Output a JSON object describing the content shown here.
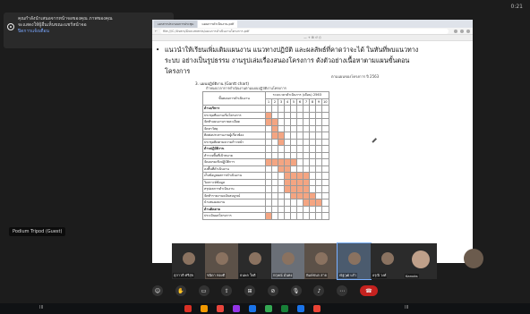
{
  "notice": {
    "line1": "คุณกำลังนำเสนอจากหน้าจอของคุณ ภาพของคุณ",
    "line2": "จะแสดงให้ผู้อื่นเห็นขณะแชร์หน้าจอ",
    "link": "ปิดการแจ้งเตือน"
  },
  "clock": "0:21",
  "browser": {
    "tabs": [
      "เอกสารประกอบการประชุม",
      "แผนการดำเนินงาน.pdf"
    ],
    "url": "file:///C:/Users/Documents/แผนการดำเนินงานโครงการ.pdf"
  },
  "doc": {
    "bullet": "แนวนำให้เรียนเพิ่มเติมแผนงาน แนวทางปฏิบัติ และผลลัพธ์ที่คาดว่าจะได้ ในทันที่พบแนวทางระบบ อย่างเป็นรูปธรรม งานรูปเล่มเรื่องสนองโครงการ ดังตัวอย่างเนื้อหาตามแผนขั้นตอนโครงการ",
    "page_note": "ตามแผนของโครงการ ปี 2563",
    "table_title": "3. แผนปฏิบัติงาน (Gantt chart)",
    "table_sub": "กำหนดเวลาการดำเนินงานตามแผนปฏิบัติงานโครงการ",
    "header_activity": "ขั้นตอนการดำเนินงาน",
    "header_period": "ระยะเวลาดำเนินการ (เดือน) 2563",
    "months": [
      "1",
      "2",
      "3",
      "4",
      "5",
      "6",
      "7",
      "8",
      "9",
      "10"
    ],
    "rows": [
      {
        "label": "ด้านบริหาร",
        "section": true,
        "cells": [
          0,
          0,
          0,
          0,
          0,
          0,
          0,
          0,
          0,
          0
        ]
      },
      {
        "label": "ประชุมทีมงานเริ่มโครงการ",
        "section": false,
        "cells": [
          1,
          0,
          0,
          0,
          0,
          0,
          0,
          0,
          0,
          0
        ]
      },
      {
        "label": "จัดทำแผนงานรายละเอียด",
        "section": false,
        "cells": [
          1,
          1,
          0,
          0,
          0,
          0,
          0,
          0,
          0,
          0
        ]
      },
      {
        "label": "จัดหาวัสดุ",
        "section": false,
        "cells": [
          0,
          1,
          0,
          0,
          0,
          0,
          0,
          0,
          0,
          0
        ]
      },
      {
        "label": "ติดต่อประสานงานผู้เกี่ยวข้อง",
        "section": false,
        "cells": [
          0,
          1,
          1,
          0,
          0,
          0,
          0,
          0,
          0,
          0
        ]
      },
      {
        "label": "ประชุมติดตามความก้าวหน้า",
        "section": false,
        "cells": [
          0,
          0,
          1,
          0,
          0,
          0,
          0,
          0,
          0,
          0
        ]
      },
      {
        "label": "ด้านปฏิบัติงาน",
        "section": true,
        "cells": [
          0,
          0,
          0,
          0,
          0,
          0,
          0,
          0,
          0,
          0
        ]
      },
      {
        "label": "สำรวจพื้นที่เป้าหมาย",
        "section": false,
        "cells": [
          0,
          0,
          0,
          0,
          0,
          0,
          0,
          0,
          0,
          0
        ]
      },
      {
        "label": "จัดอบรมเชิงปฏิบัติการ",
        "section": false,
        "cells": [
          1,
          1,
          1,
          1,
          1,
          0,
          0,
          0,
          0,
          0
        ]
      },
      {
        "label": "ลงพื้นที่ดำเนินงาน",
        "section": false,
        "cells": [
          0,
          0,
          1,
          1,
          0,
          0,
          0,
          0,
          0,
          0
        ]
      },
      {
        "label": "เก็บข้อมูลผลการดำเนินงาน",
        "section": false,
        "cells": [
          0,
          0,
          0,
          1,
          1,
          1,
          1,
          0,
          0,
          0
        ]
      },
      {
        "label": "วิเคราะห์ข้อมูล",
        "section": false,
        "cells": [
          0,
          0,
          0,
          1,
          1,
          1,
          1,
          0,
          0,
          0
        ]
      },
      {
        "label": "สรุปผลการดำเนินงาน",
        "section": false,
        "cells": [
          0,
          0,
          0,
          1,
          1,
          1,
          1,
          0,
          0,
          0
        ]
      },
      {
        "label": "จัดทำรายงานฉบับสมบูรณ์",
        "section": false,
        "cells": [
          0,
          0,
          0,
          0,
          1,
          1,
          1,
          1,
          0,
          0
        ]
      },
      {
        "label": "นำเสนอผลงาน",
        "section": false,
        "cells": [
          0,
          0,
          0,
          0,
          0,
          0,
          1,
          1,
          1,
          0
        ]
      },
      {
        "label": "ด้านติดตาม",
        "section": true,
        "cells": [
          0,
          0,
          0,
          0,
          0,
          0,
          0,
          0,
          0,
          0
        ]
      },
      {
        "label": "ประเมินผลโครงการ",
        "section": false,
        "cells": [
          1,
          0,
          0,
          0,
          0,
          0,
          0,
          0,
          0,
          0
        ]
      }
    ]
  },
  "self_label": "Podium Tripod (Guest)",
  "participants": [
    {
      "name": "สุภาวดี ศรีสุข"
    },
    {
      "name": "ชนิดา ทองดี"
    },
    {
      "name": "ธนพล ใจดี"
    },
    {
      "name": "กฤษณ์ มั่นคง"
    },
    {
      "name": "พิมพ์ชนก สาย"
    },
    {
      "name": "ณัฐวุฒิ แก้ว"
    },
    {
      "name": "อรุณี วงศ์"
    },
    {
      "name": "Kanoks"
    }
  ],
  "controls": [
    "reactions-icon",
    "raise-hand-icon",
    "captions-icon",
    "present-icon",
    "grid-icon",
    "camera-off-icon",
    "mic-off-icon",
    "volume-icon",
    "more-icon",
    "end-call-icon"
  ],
  "taskbar": {
    "left": "III",
    "right": "III",
    "colors": [
      "#d93025",
      "#f29900",
      "#e8453c",
      "#9334e6",
      "#1a73e8",
      "#34a853",
      "#188038",
      "#1a73e8",
      "#ea4335"
    ]
  }
}
